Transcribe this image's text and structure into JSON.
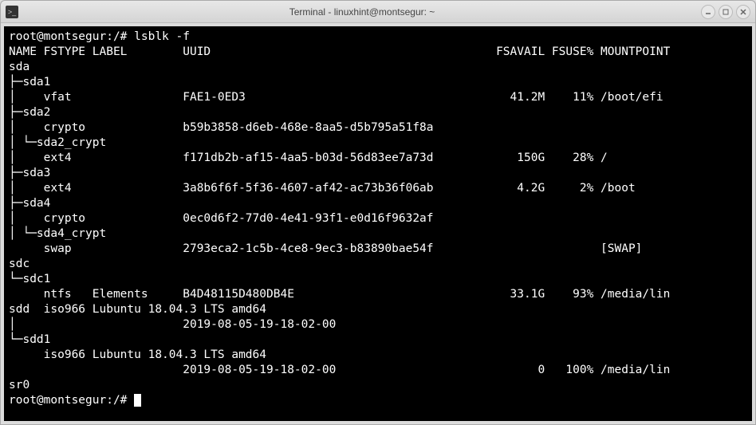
{
  "window": {
    "title": "Terminal - linuxhint@montsegur: ~"
  },
  "prompt1": "root@montsegur:/# ",
  "command": "lsblk -f",
  "header": {
    "name": "NAME",
    "fstype": "FSTYPE",
    "label": "LABEL",
    "uuid": "UUID",
    "fsavail": "FSAVAIL",
    "fsuse": "FSUSE%",
    "mountpoint": "MOUNTPOINT"
  },
  "rows": [
    {
      "tree": "sda",
      "fstype": "",
      "label": "",
      "uuid": "",
      "fsavail": "",
      "fsuse": "",
      "mount": ""
    },
    {
      "tree": "├─sda1",
      "fstype": "",
      "label": "",
      "uuid": "",
      "fsavail": "",
      "fsuse": "",
      "mount": ""
    },
    {
      "tree": "│    ",
      "fstype": "vfat",
      "label": "",
      "uuid": "FAE1-0ED3",
      "fsavail": "41.2M",
      "fsuse": "11%",
      "mount": "/boot/efi"
    },
    {
      "tree": "├─sda2",
      "fstype": "",
      "label": "",
      "uuid": "",
      "fsavail": "",
      "fsuse": "",
      "mount": ""
    },
    {
      "tree": "│    ",
      "fstype": "crypto",
      "label": "",
      "uuid": "b59b3858-d6eb-468e-8aa5-d5b795a51f8a",
      "fsavail": "",
      "fsuse": "",
      "mount": ""
    },
    {
      "tree": "│ └─sda2_crypt",
      "fstype": "",
      "label": "",
      "uuid": "",
      "fsavail": "",
      "fsuse": "",
      "mount": ""
    },
    {
      "tree": "│    ",
      "fstype": "ext4",
      "label": "",
      "uuid": "f171db2b-af15-4aa5-b03d-56d83ee7a73d",
      "fsavail": "150G",
      "fsuse": "28%",
      "mount": "/"
    },
    {
      "tree": "├─sda3",
      "fstype": "",
      "label": "",
      "uuid": "",
      "fsavail": "",
      "fsuse": "",
      "mount": ""
    },
    {
      "tree": "│    ",
      "fstype": "ext4",
      "label": "",
      "uuid": "3a8b6f6f-5f36-4607-af42-ac73b36f06ab",
      "fsavail": "4.2G",
      "fsuse": "2%",
      "mount": "/boot"
    },
    {
      "tree": "├─sda4",
      "fstype": "",
      "label": "",
      "uuid": "",
      "fsavail": "",
      "fsuse": "",
      "mount": ""
    },
    {
      "tree": "│    ",
      "fstype": "crypto",
      "label": "",
      "uuid": "0ec0d6f2-77d0-4e41-93f1-e0d16f9632af",
      "fsavail": "",
      "fsuse": "",
      "mount": ""
    },
    {
      "tree": "│ └─sda4_crypt",
      "fstype": "",
      "label": "",
      "uuid": "",
      "fsavail": "",
      "fsuse": "",
      "mount": ""
    },
    {
      "tree": "     ",
      "fstype": "swap",
      "label": "",
      "uuid": "2793eca2-1c5b-4ce8-9ec3-b83890bae54f",
      "fsavail": "",
      "fsuse": "",
      "mount": "[SWAP]"
    },
    {
      "tree": "sdc",
      "fstype": "",
      "label": "",
      "uuid": "",
      "fsavail": "",
      "fsuse": "",
      "mount": ""
    },
    {
      "tree": "└─sdc1",
      "fstype": "",
      "label": "",
      "uuid": "",
      "fsavail": "",
      "fsuse": "",
      "mount": ""
    },
    {
      "tree": "     ",
      "fstype": "ntfs",
      "label": "Elements",
      "uuid": "B4D48115D480DB4E",
      "fsavail": "33.1G",
      "fsuse": "93%",
      "mount": "/media/lin"
    },
    {
      "tree": "sdd  ",
      "fstype": "iso966",
      "label": "Lubuntu 18.04.3 LTS amd64",
      "uuid": "",
      "fsavail": "",
      "fsuse": "",
      "mount": ""
    },
    {
      "tree": "│    ",
      "fstype": "",
      "label": "",
      "uuid": "2019-08-05-19-18-02-00",
      "fsavail": "",
      "fsuse": "",
      "mount": ""
    },
    {
      "tree": "└─sdd1",
      "fstype": "",
      "label": "",
      "uuid": "",
      "fsavail": "",
      "fsuse": "",
      "mount": ""
    },
    {
      "tree": "     ",
      "fstype": "iso966",
      "label": "Lubuntu 18.04.3 LTS amd64",
      "uuid": "",
      "fsavail": "",
      "fsuse": "",
      "mount": ""
    },
    {
      "tree": "     ",
      "fstype": "",
      "label": "",
      "uuid": "2019-08-05-19-18-02-00",
      "fsavail": "0",
      "fsuse": "100%",
      "mount": "/media/lin"
    },
    {
      "tree": "sr0",
      "fstype": "",
      "label": "",
      "uuid": "",
      "fsavail": "",
      "fsuse": "",
      "mount": ""
    }
  ],
  "prompt2": "root@montsegur:/# ",
  "cols": {
    "fstype": 5,
    "label": 12,
    "uuid": 25,
    "fsavail": 70,
    "fsuse": 78,
    "mount": 85
  }
}
